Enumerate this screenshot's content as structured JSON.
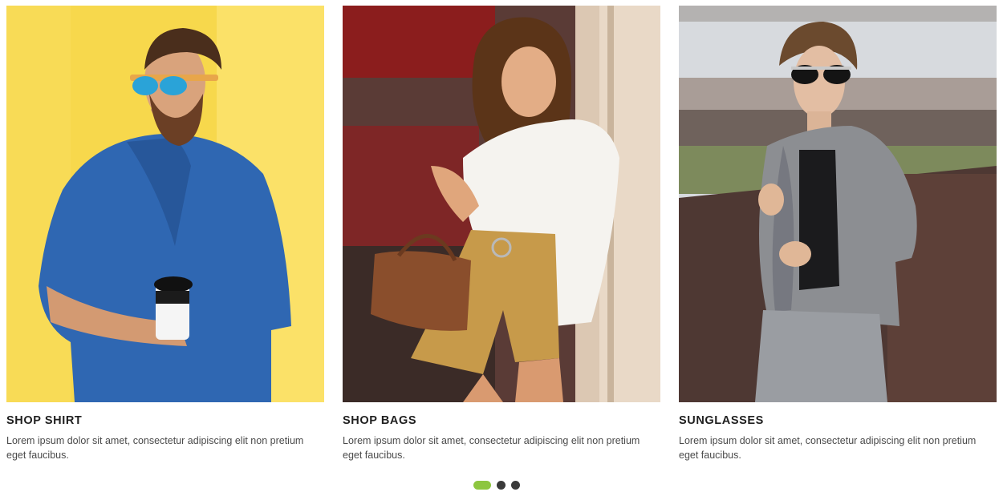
{
  "carousel": {
    "slides": [
      {
        "title": "SHOP SHIRT",
        "text": "Lorem ipsum dolor sit amet, consectetur adipiscing elit non pretium eget faucibus.",
        "image": "man-denim-shirt-coffee-photo"
      },
      {
        "title": "SHOP BAGS",
        "text": "Lorem ipsum dolor sit amet, consectetur adipiscing elit non pretium eget faucibus.",
        "image": "woman-brown-handbag-photo"
      },
      {
        "title": "SUNGLASSES",
        "text": "Lorem ipsum dolor sit amet, consectetur adipiscing elit non pretium eget faucibus.",
        "image": "woman-sunglasses-grey-suit-photo"
      }
    ],
    "pagination": {
      "count": 3,
      "active_index": 0
    }
  },
  "colors": {
    "accent": "#8dc63f",
    "dot_inactive": "#3a3a3a",
    "title": "#1f1f1f",
    "body_text": "#4a4a4a"
  }
}
